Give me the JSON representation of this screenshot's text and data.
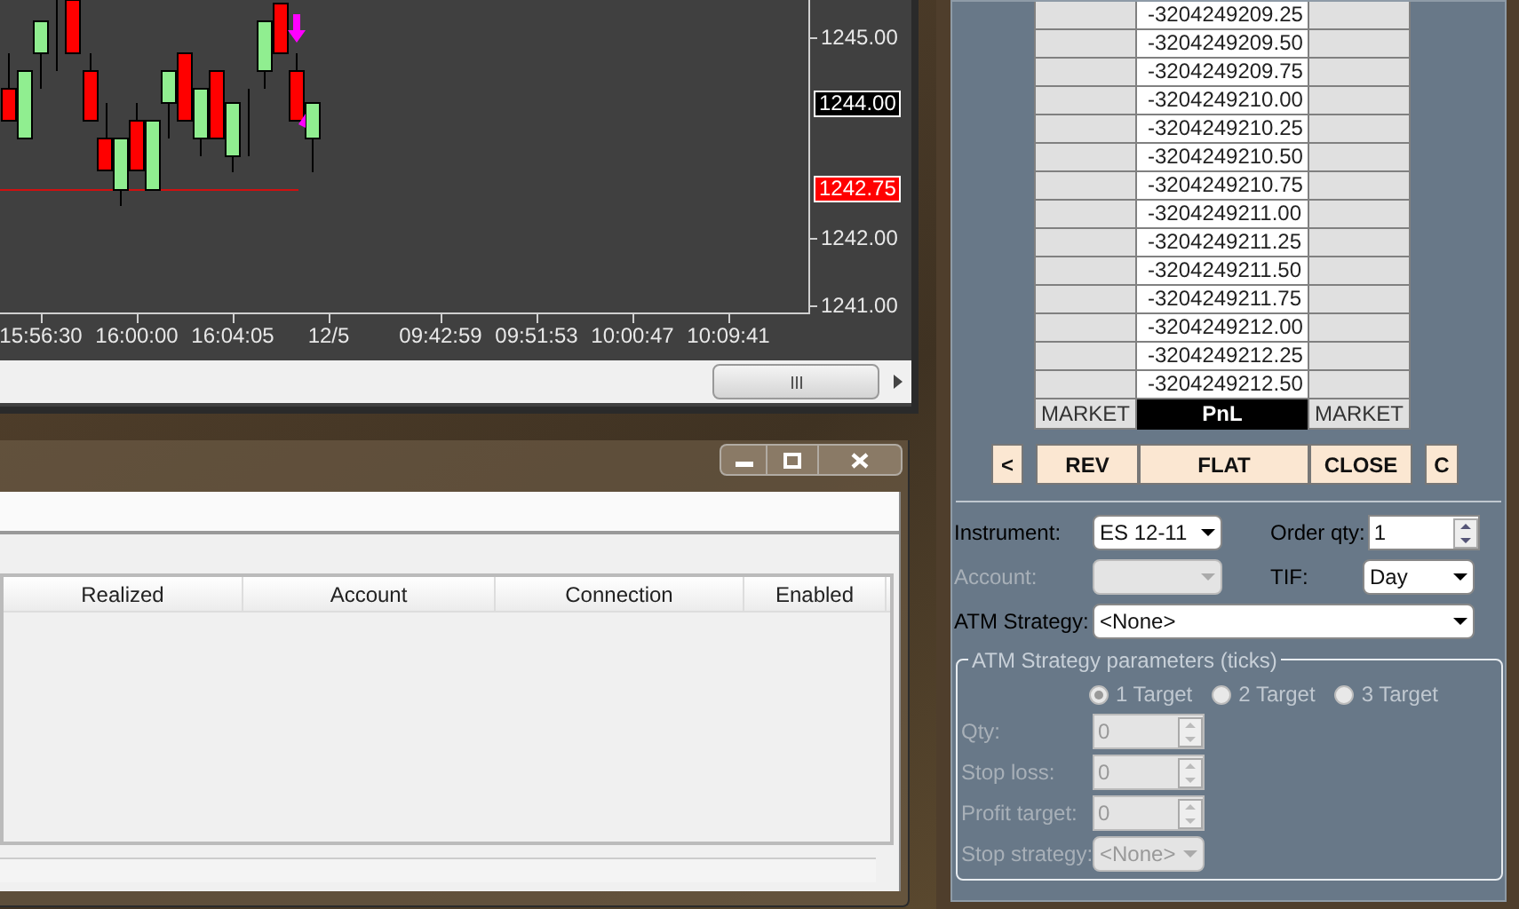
{
  "chart_window": {
    "y_axis_labels": [
      "1245.00",
      "1242.00",
      "1241.00"
    ],
    "price_markers": [
      {
        "text": "1244.00",
        "kind": "last"
      },
      {
        "text": "1242.75",
        "kind": "position"
      }
    ],
    "x_axis_labels": [
      "15:56:30",
      "16:00:00",
      "16:04:05",
      "12/5",
      "09:42:59",
      "09:51:53",
      "10:00:47",
      "10:09:41"
    ]
  },
  "positions_window": {
    "columns": [
      "Realized",
      "Account",
      "Connection",
      "Enabled"
    ]
  },
  "order_panel": {
    "ladder_rows": [
      {
        "price": "-3204249209.25"
      },
      {
        "price": "-3204249209.50"
      },
      {
        "price": "-3204249209.75"
      },
      {
        "price": "-3204249210.00"
      },
      {
        "price": "-3204249210.25"
      },
      {
        "price": "-3204249210.50"
      },
      {
        "price": "-3204249210.75"
      },
      {
        "price": "-3204249211.00"
      },
      {
        "price": "-3204249211.25"
      },
      {
        "price": "-3204249211.50"
      },
      {
        "price": "-3204249211.75"
      },
      {
        "price": "-3204249212.00"
      },
      {
        "price": "-3204249212.25"
      },
      {
        "price": "-3204249212.50"
      }
    ],
    "footer": {
      "left": "MARKET",
      "center": "PnL",
      "right": "MARKET"
    },
    "buttons": [
      "<",
      "REV",
      "FLAT",
      "CLOSE",
      "C"
    ],
    "instrument": {
      "label": "Instrument:",
      "value": "ES 12-11"
    },
    "order_qty": {
      "label": "Order qty:",
      "value": "1"
    },
    "account": {
      "label": "Account:",
      "disabled": true
    },
    "tif": {
      "label": "TIF:",
      "value": "Day"
    },
    "atm_strategy": {
      "label": "ATM Strategy:",
      "value": "<None>"
    },
    "atm_group": {
      "title": "ATM Strategy parameters (ticks)",
      "disabled": true,
      "targets": [
        {
          "label": "1 Target",
          "selected": true
        },
        {
          "label": "2 Target",
          "selected": false
        },
        {
          "label": "3 Target",
          "selected": false
        }
      ],
      "params": [
        {
          "kind": "spin",
          "label": "Qty:",
          "value": "0"
        },
        {
          "kind": "spin",
          "label": "Stop loss:",
          "value": "0"
        },
        {
          "kind": "spin",
          "label": "Profit target:",
          "value": "0"
        },
        {
          "kind": "dropdown",
          "label": "Stop strategy:",
          "value": "<None>"
        }
      ]
    }
  }
}
